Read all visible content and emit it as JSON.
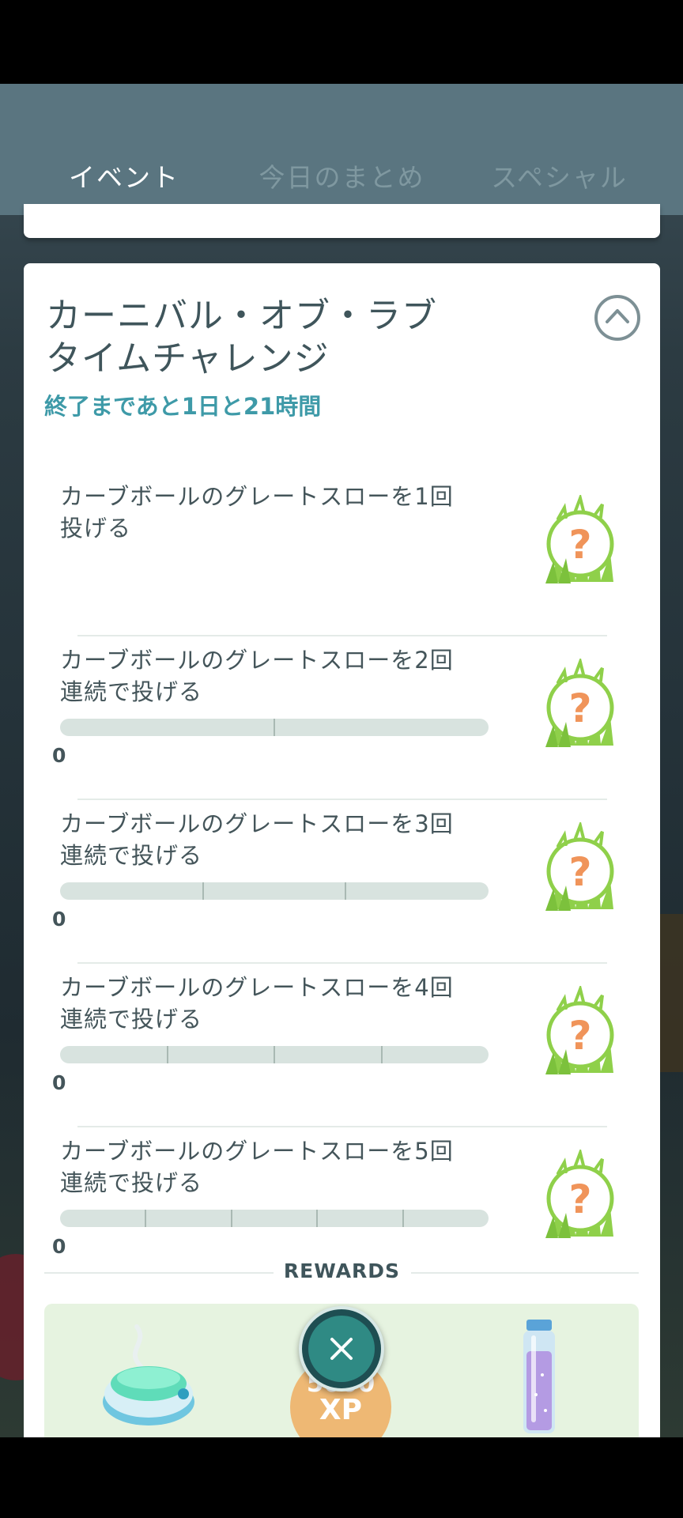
{
  "tabs": [
    {
      "label": "イベント",
      "active": true
    },
    {
      "label": "今日のまとめ",
      "active": false
    },
    {
      "label": "スペシャル",
      "active": false
    }
  ],
  "card": {
    "title_line1": "カーニバル・オブ・ラブ",
    "title_line2": "タイムチャレンジ",
    "timer": "終了まであと1日と21時間",
    "tasks": [
      {
        "line1": "カーブボールのグレートスローを1回",
        "line2": "投げる",
        "progress_value": null,
        "steps": 1
      },
      {
        "line1": "カーブボールのグレートスローを2回",
        "line2": "連続で投げる",
        "progress_value": "0",
        "steps": 2
      },
      {
        "line1": "カーブボールのグレートスローを3回",
        "line2": "連続で投げる",
        "progress_value": "0",
        "steps": 3
      },
      {
        "line1": "カーブボールのグレートスローを4回",
        "line2": "連続で投げる",
        "progress_value": "0",
        "steps": 4
      },
      {
        "line1": "カーブボールのグレートスローを5回",
        "line2": "連続で投げる",
        "progress_value": "0",
        "steps": 5
      }
    ],
    "reward_icon": "mystery-encounter-icon",
    "rewards_label": "REWARDS",
    "rewards": [
      {
        "icon": "incense-icon"
      },
      {
        "xp_amount": "5000",
        "xp_unit": "XP"
      },
      {
        "icon": "stardust-vial-icon"
      }
    ]
  },
  "close_icon": "close-icon",
  "colors": {
    "tab_bar": "#5a7580",
    "timer": "#3e9aa8",
    "progress_track": "#d8e3df",
    "rewards_panel": "#e6f3e0",
    "xp_badge": "#eeb874",
    "close_button": "#2f8a84"
  }
}
